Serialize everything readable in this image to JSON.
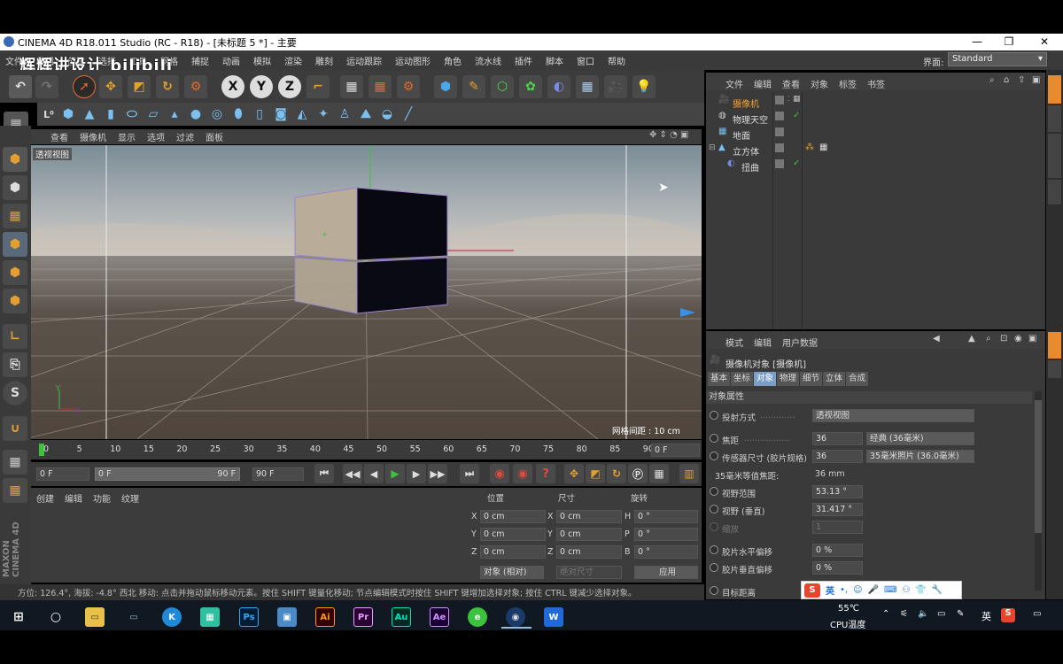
{
  "window": {
    "title": "CINEMA 4D R18.011 Studio (RC - R18) - [未标题 5 *] - 主要"
  },
  "watermark": "辉辉讲设计 bilibili",
  "menu": [
    "文件",
    "编辑",
    "创建",
    "选择",
    "工具",
    "网格",
    "捕捉",
    "动画",
    "模拟",
    "渲染",
    "雕刻",
    "运动跟踪",
    "运动图形",
    "角色",
    "流水线",
    "插件",
    "脚本",
    "窗口",
    "帮助"
  ],
  "layout": {
    "label": "界面:",
    "value": "Standard"
  },
  "toolbar": {
    "undo": "undo-icon",
    "axis_x": "X",
    "axis_y": "Y",
    "axis_z": "Z"
  },
  "viewport": {
    "menu": [
      "查看",
      "摄像机",
      "显示",
      "选项",
      "过滤",
      "面板"
    ],
    "label": "透视视图",
    "grid_spacing": "网格间距 : 10 cm"
  },
  "timeline": {
    "ticks": [
      "0",
      "5",
      "10",
      "15",
      "20",
      "25",
      "30",
      "35",
      "40",
      "45",
      "50",
      "55",
      "60",
      "65",
      "70",
      "75",
      "80",
      "85",
      "90"
    ],
    "frame_field": "0 F",
    "start": "0 F",
    "slider_left": "0 F",
    "slider_right": "90 F",
    "end": "90 F"
  },
  "material_manager": {
    "menu": [
      "创建",
      "编辑",
      "功能",
      "纹理"
    ]
  },
  "coordinates": {
    "headers": [
      "位置",
      "尺寸",
      "旋转"
    ],
    "rows": [
      {
        "a": "X",
        "pos": "0 cm",
        "b": "X",
        "size": "0 cm",
        "c": "H",
        "rot": "0 °"
      },
      {
        "a": "Y",
        "pos": "0 cm",
        "b": "Y",
        "size": "0 cm",
        "c": "P",
        "rot": "0 °"
      },
      {
        "a": "Z",
        "pos": "0 cm",
        "b": "Z",
        "size": "0 cm",
        "c": "B",
        "rot": "0 °"
      }
    ],
    "mode": "对象 (相对)",
    "size_mode": "绝对尺寸",
    "apply": "应用"
  },
  "status": "方位: 126.4°, 海拔: -4.8° 西北    移动: 点击并拖动鼠标移动元素。按住 SHIFT 键量化移动; 节点编辑模式时按住 SHIFT 键增加选择对象; 按住 CTRL 键减少选择对象。",
  "object_manager": {
    "menu": [
      "文件",
      "编辑",
      "查看",
      "对象",
      "标签",
      "书签"
    ],
    "objects": [
      {
        "name": "摄像机",
        "highlight": true
      },
      {
        "name": "物理天空",
        "highlight": false
      },
      {
        "name": "地面",
        "highlight": false
      },
      {
        "name": "立方体",
        "highlight": false
      },
      {
        "name": "扭曲",
        "highlight": false
      }
    ]
  },
  "attributes": {
    "menu": [
      "模式",
      "编辑",
      "用户数据"
    ],
    "title": "摄像机对象 [摄像机]",
    "tabs": [
      "基本",
      "坐标",
      "对象",
      "物理",
      "细节",
      "立体",
      "合成"
    ],
    "active_tab": "对象",
    "section": "对象属性",
    "projection_label": "投射方式",
    "projection_value": "透视视图",
    "focal_label": "焦距",
    "focal_value": "36",
    "focal_preset": "经典 (36毫米)",
    "sensor_label": "传感器尺寸 (胶片规格)",
    "sensor_value": "36",
    "sensor_preset": "35毫米照片 (36.0毫米)",
    "equiv_label": "35毫米等值焦距:",
    "equiv_value": "36 mm",
    "fov_label": "视野范围",
    "fov_value": "53.13 °",
    "fovv_label": "视野 (垂直)",
    "fovv_value": "31.417 °",
    "zoom_label": "缩放",
    "zoom_value": "1",
    "filmh_label": "胶片水平偏移",
    "filmh_value": "0 %",
    "filmv_label": "胶片垂直偏移",
    "filmv_value": "0 %",
    "target_label": "目标距离"
  },
  "ime": {
    "lang": "英"
  },
  "taskbar": {
    "temp": "55℃",
    "temp_label": "CPU温度",
    "lang": "英"
  }
}
